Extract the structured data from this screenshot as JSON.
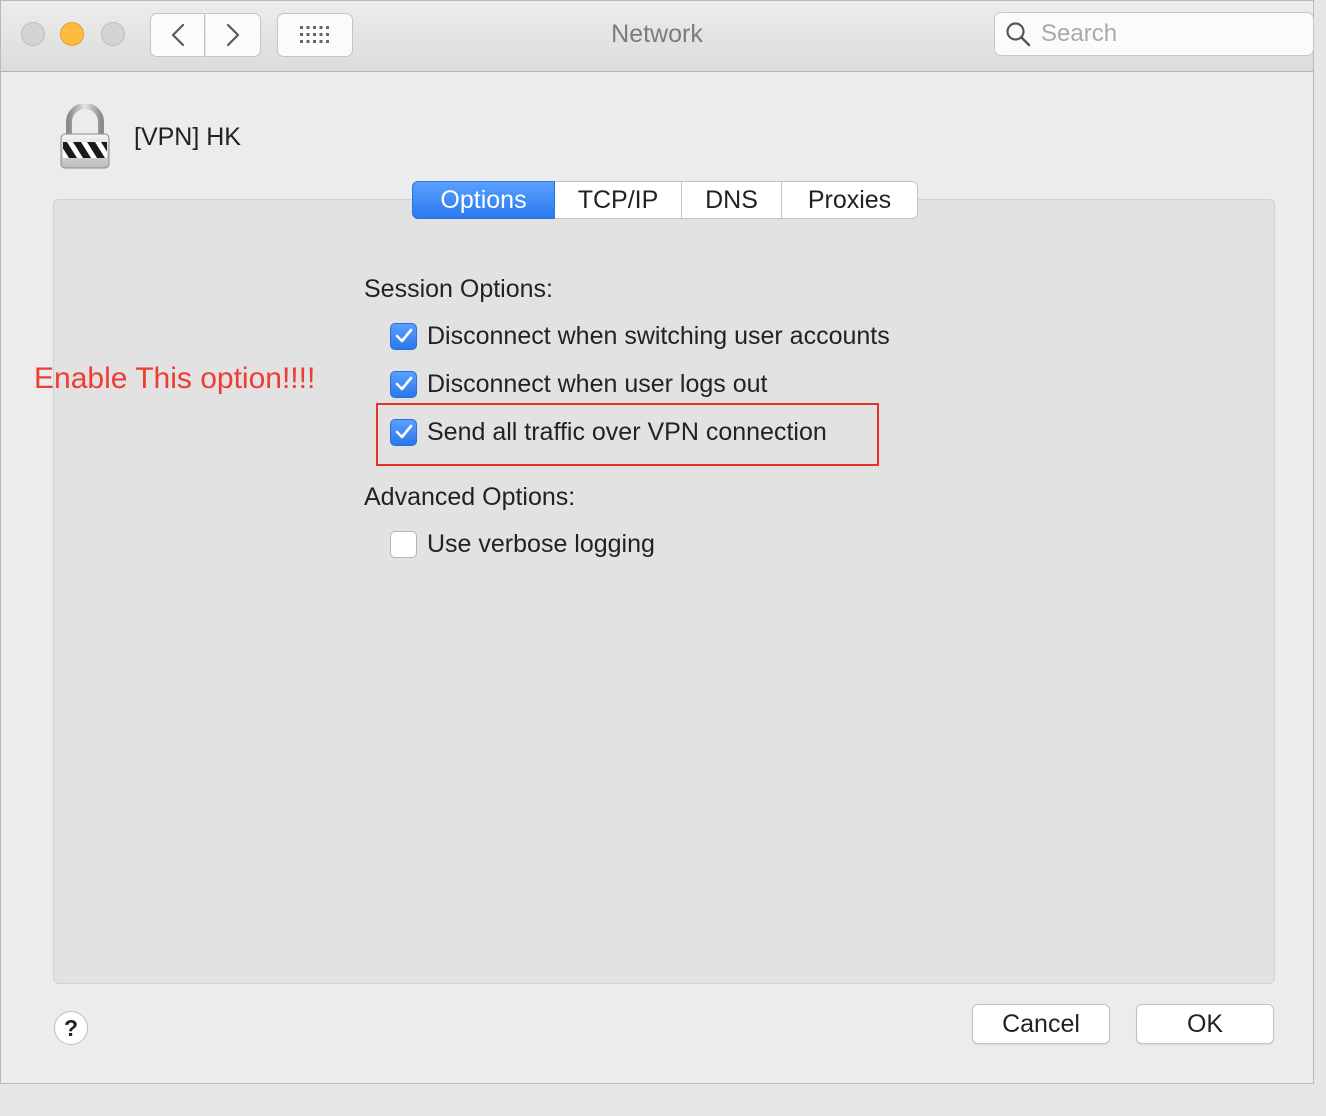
{
  "window": {
    "title": "Network"
  },
  "toolbar": {
    "back_icon": "chevron-left",
    "forward_icon": "chevron-right",
    "grid_icon": "show-all-grid",
    "search_placeholder": "Search"
  },
  "connection": {
    "name": "[VPN] HK",
    "icon": "vpn-lock"
  },
  "tabs": [
    {
      "label": "Options",
      "active": true
    },
    {
      "label": "TCP/IP",
      "active": false
    },
    {
      "label": "DNS",
      "active": false
    },
    {
      "label": "Proxies",
      "active": false
    }
  ],
  "session_options": {
    "heading": "Session Options:",
    "items": [
      {
        "label": "Disconnect when switching user accounts",
        "checked": true
      },
      {
        "label": "Disconnect when user logs out",
        "checked": true
      },
      {
        "label": "Send all traffic over VPN connection",
        "checked": true
      }
    ]
  },
  "advanced_options": {
    "heading": "Advanced Options:",
    "items": [
      {
        "label": "Use verbose logging",
        "checked": false
      }
    ]
  },
  "annotation": {
    "text": "Enable This option!!!!",
    "color": "#ee3c34"
  },
  "footer": {
    "help_label": "?",
    "cancel_label": "Cancel",
    "ok_label": "OK"
  },
  "colors": {
    "accent": "#2a79f0",
    "close": "#d3d3d3",
    "minimize": "#fdbc40"
  }
}
